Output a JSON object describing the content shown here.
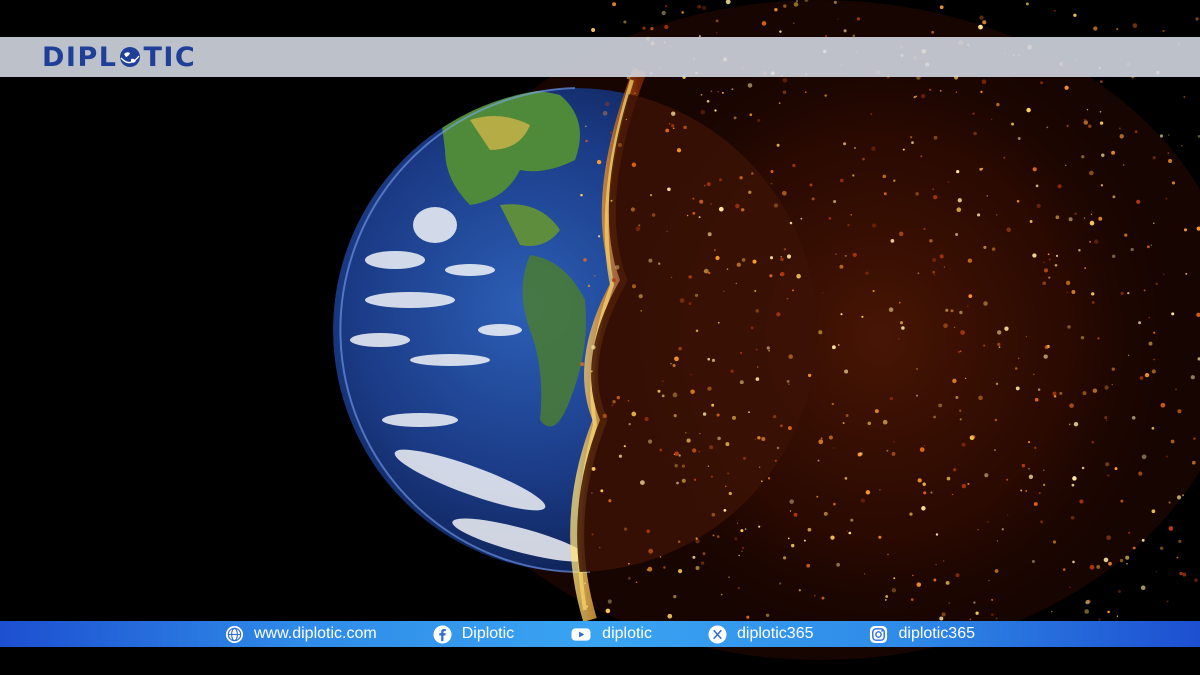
{
  "brand": {
    "prefix": "DIPL",
    "suffix": "TIC",
    "brand_color": "#1f3f99",
    "globe_icon": "globe-icon"
  },
  "social": {
    "website": {
      "label": "www.diplotic.com",
      "icon": "globe-icon"
    },
    "facebook": {
      "label": "Diplotic",
      "icon": "facebook-icon"
    },
    "youtube": {
      "label": "diplotic",
      "icon": "youtube-icon"
    },
    "x": {
      "label": "diplotic365",
      "icon": "x-icon"
    },
    "instagram": {
      "label": "diplotic365",
      "icon": "instagram-icon"
    }
  },
  "colors": {
    "bar_blue": "#2f8be8",
    "ocean": "#1c3f8a",
    "fire": "#e0651b"
  }
}
